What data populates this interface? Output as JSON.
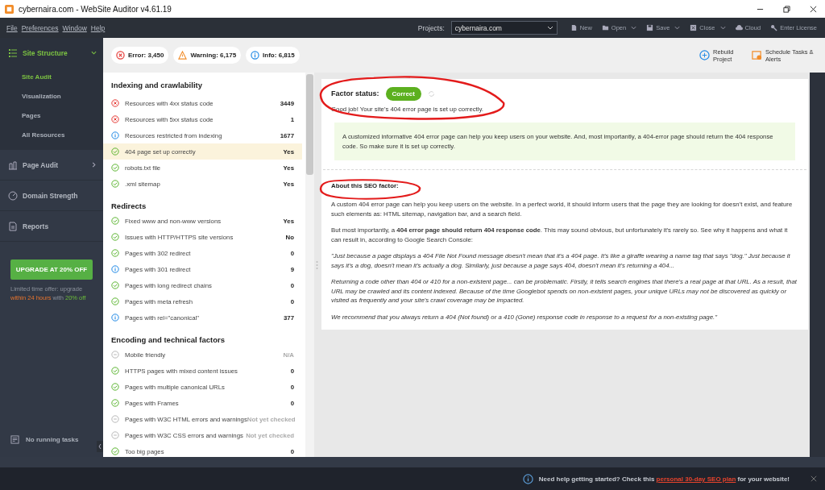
{
  "window": {
    "title": "cybernaira.com - WebSite Auditor v4.61.19"
  },
  "menu": [
    "File",
    "Preferences",
    "Window",
    "Help"
  ],
  "toolbar": {
    "projects_label": "Projects:",
    "project": "cybernaira.com",
    "buttons": [
      {
        "kind": "new",
        "label": "New",
        "caret": false
      },
      {
        "kind": "open",
        "label": "Open",
        "caret": true
      },
      {
        "kind": "save",
        "label": "Save",
        "caret": true
      },
      {
        "kind": "close",
        "label": "Close",
        "caret": true
      },
      {
        "kind": "cloud",
        "label": "Cloud",
        "caret": false
      },
      {
        "kind": "license",
        "label": "Enter License",
        "caret": false
      }
    ]
  },
  "sidebar": {
    "items": [
      {
        "kind": "structure",
        "label": "Site Structure",
        "selected": true,
        "expanded": true,
        "children": [
          {
            "label": "Site Audit",
            "selected": true
          },
          {
            "label": "Visualization",
            "selected": false
          },
          {
            "label": "Pages",
            "selected": false
          },
          {
            "label": "All Resources",
            "selected": false
          }
        ]
      },
      {
        "kind": "page",
        "label": "Page Audit",
        "selected": false,
        "expanded": false
      },
      {
        "kind": "domain",
        "label": "Domain Strength",
        "selected": false
      },
      {
        "kind": "reports",
        "label": "Reports",
        "selected": false
      }
    ],
    "upgrade_button": "UPGRADE AT 20% OFF",
    "offer": [
      {
        "text": "Limited time offer: upgrade ",
        "kind": "muted"
      },
      {
        "text": "within 24 hours",
        "kind": "orange"
      },
      {
        "text": " with ",
        "kind": "muted"
      },
      {
        "text": "20% off",
        "kind": "green"
      }
    ],
    "tasks": "No running tasks"
  },
  "summary": [
    {
      "kind": "error",
      "label": "Error: 3,450"
    },
    {
      "kind": "warning",
      "label": "Warning: 6,175"
    },
    {
      "kind": "info",
      "label": "Info: 6,815"
    }
  ],
  "actions": [
    {
      "kind": "rebuild",
      "label": "Rebuild Project"
    },
    {
      "kind": "schedule",
      "label": "Schedule Tasks & Alerts"
    }
  ],
  "sections": [
    {
      "title": "Indexing and crawlability",
      "rows": [
        {
          "kind": "error",
          "label": "Resources with 4xx status code",
          "value": "3449",
          "selected": false
        },
        {
          "kind": "error",
          "label": "Resources with 5xx status code",
          "value": "1",
          "selected": false
        },
        {
          "kind": "info",
          "label": "Resources restricted from indexing",
          "value": "1677",
          "selected": false
        },
        {
          "kind": "ok",
          "label": "404 page set up correctly",
          "value": "Yes",
          "selected": true
        },
        {
          "kind": "ok",
          "label": "robots.txt file",
          "value": "Yes",
          "selected": false
        },
        {
          "kind": "ok",
          "label": ".xml sitemap",
          "value": "Yes",
          "selected": false
        }
      ]
    },
    {
      "title": "Redirects",
      "rows": [
        {
          "kind": "ok",
          "label": "Fixed www and non-www versions",
          "value": "Yes",
          "selected": false
        },
        {
          "kind": "ok",
          "label": "Issues with HTTP/HTTPS site versions",
          "value": "No",
          "selected": false
        },
        {
          "kind": "ok",
          "label": "Pages with 302 redirect",
          "value": "0",
          "selected": false
        },
        {
          "kind": "info",
          "label": "Pages with 301 redirect",
          "value": "9",
          "selected": false
        },
        {
          "kind": "ok",
          "label": "Pages with long redirect chains",
          "value": "0",
          "selected": false
        },
        {
          "kind": "ok",
          "label": "Pages with meta refresh",
          "value": "0",
          "selected": false
        },
        {
          "kind": "info",
          "label": "Pages with rel=\"canonical\"",
          "value": "377",
          "selected": false
        }
      ]
    },
    {
      "title": "Encoding and technical factors",
      "rows": [
        {
          "kind": "na",
          "label": "Mobile friendly",
          "value": "N/A",
          "selected": false
        },
        {
          "kind": "ok",
          "label": "HTTPS pages with mixed content issues",
          "value": "0",
          "selected": false
        },
        {
          "kind": "ok",
          "label": "Pages with multiple canonical URLs",
          "value": "0",
          "selected": false
        },
        {
          "kind": "ok",
          "label": "Pages with Frames",
          "value": "0",
          "selected": false
        },
        {
          "kind": "na",
          "label": "Pages with W3C HTML errors and warnings",
          "value": "Not yet checked",
          "selected": false
        },
        {
          "kind": "na",
          "label": "Pages with W3C CSS errors and warnings",
          "value": "Not yet checked",
          "selected": false
        },
        {
          "kind": "ok",
          "label": "Too big pages",
          "value": "0",
          "selected": false
        }
      ]
    }
  ],
  "details": {
    "factor_label": "Factor status:",
    "status": {
      "kind": "correct",
      "label": "Correct"
    },
    "factor_circled": true,
    "result": "Good job! Your site's 404 error page is set up correctly.",
    "tip": "A customized informative 404 error page can help you keep users on your website. And, most importantly, a 404-error page should return the 404 response code. So make sure it is set up correctly.",
    "about_title": "About this SEO factor:",
    "about_circled": true,
    "paragraphs": [
      {
        "kind": "plain",
        "text": "A custom 404 error page can help you keep users on the website. In a perfect world, it should inform users that the page they are looking for doesn't exist, and feature such elements as: HTML sitemap, navigation bar, and a search field."
      },
      {
        "kind": "plain",
        "text": "But most importantly, a **404 error page should return 404 response code**. This may sound obvious, but unfortunately it's rarely so. See why it happens and what it can result in, according to Google Search Console:"
      },
      {
        "kind": "quote",
        "text": "\"Just because a page displays a 404 File Not Found message doesn't mean that it's a 404 page. It's like a giraffe wearing a name tag that says \"dog.\" Just because it says it's a dog, doesn't mean it's actually a dog. Similarly, just because a page says 404, doesn't mean it's returning a 404..."
      },
      {
        "kind": "quote",
        "text": "Returning a code other than 404 or 410 for a non-existent page... can be problematic. Firstly, it tells search engines that there's a real page at that URL. As a result, that URL may be crawled and its content indexed. Because of the time Googlebot spends on non-existent pages, your unique URLs may not be discovered as quickly or visited as frequently and your site's crawl coverage may be impacted."
      },
      {
        "kind": "quote",
        "text": "We recommend that you always return a 404 (Not found) or a 410 (Gone) response code in response to a request for a non-existing page.\""
      }
    ]
  },
  "notice": {
    "before": "Need help getting started? Check this ",
    "link": "personal 30-day SEO plan",
    "after": " for your website!"
  }
}
